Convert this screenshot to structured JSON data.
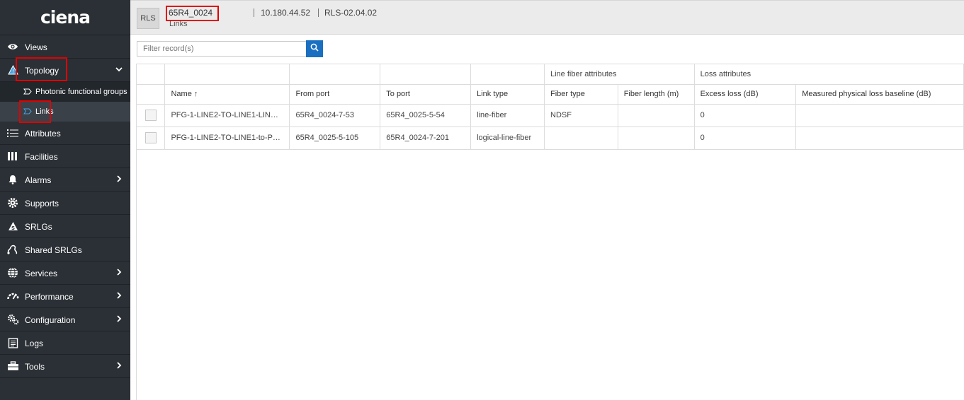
{
  "sidebar": {
    "logo": "ciena",
    "items": [
      {
        "label": "Views",
        "icon": "eye-icon"
      },
      {
        "label": "Topology",
        "icon": "topology-icon",
        "expanded": true,
        "children": [
          {
            "label": "Photonic functional groups",
            "icon": "tag-icon"
          },
          {
            "label": "Links",
            "icon": "tag-icon",
            "active": true
          }
        ]
      },
      {
        "label": "Attributes",
        "icon": "list-icon"
      },
      {
        "label": "Facilities",
        "icon": "facilities-icon"
      },
      {
        "label": "Alarms",
        "icon": "bell-icon",
        "has_children": true
      },
      {
        "label": "Supports",
        "icon": "gear-icon"
      },
      {
        "label": "SRLGs",
        "icon": "srlg-icon"
      },
      {
        "label": "Shared SRLGs",
        "icon": "shared-srlg-icon"
      },
      {
        "label": "Services",
        "icon": "globe-icon",
        "has_children": true
      },
      {
        "label": "Performance",
        "icon": "gauge-icon",
        "has_children": true
      },
      {
        "label": "Configuration",
        "icon": "config-icon",
        "has_children": true
      },
      {
        "label": "Logs",
        "icon": "log-icon"
      },
      {
        "label": "Tools",
        "icon": "toolbox-icon",
        "has_children": true
      }
    ]
  },
  "header": {
    "badge": "RLS",
    "node_name": "65R4_0024",
    "subtitle": "Links",
    "ip": "10.180.44.52",
    "release": "RLS-02.04.02"
  },
  "filter": {
    "placeholder": "Filter record(s)"
  },
  "table": {
    "groups": {
      "line_fiber": "Line fiber attributes",
      "loss": "Loss attributes"
    },
    "columns": [
      "Name",
      "From port",
      "To port",
      "Link type",
      "Fiber type",
      "Fiber length (m)",
      "Excess loss (dB)",
      "Measured physical loss baseline (dB)"
    ],
    "sort_indicator": "↑",
    "rows": [
      {
        "name": "PFG-1-LINE2-TO-LINE1-LINEO...",
        "from_port": "65R4_0024-7-53",
        "to_port": "65R4_0025-5-54",
        "link_type": "line-fiber",
        "fiber_type": "NDSF",
        "fiber_length": "",
        "excess_loss": "0",
        "measured_loss": ""
      },
      {
        "name": "PFG-1-LINE2-TO-LINE1-to-PF...",
        "from_port": "65R4_0025-5-105",
        "to_port": "65R4_0024-7-201",
        "link_type": "logical-line-fiber",
        "fiber_type": "",
        "fiber_length": "",
        "excess_loss": "0",
        "measured_loss": ""
      }
    ]
  },
  "colors": {
    "sidebar_bg": "#2b3036",
    "accent": "#1a6fc1",
    "highlight": "#e10000"
  }
}
